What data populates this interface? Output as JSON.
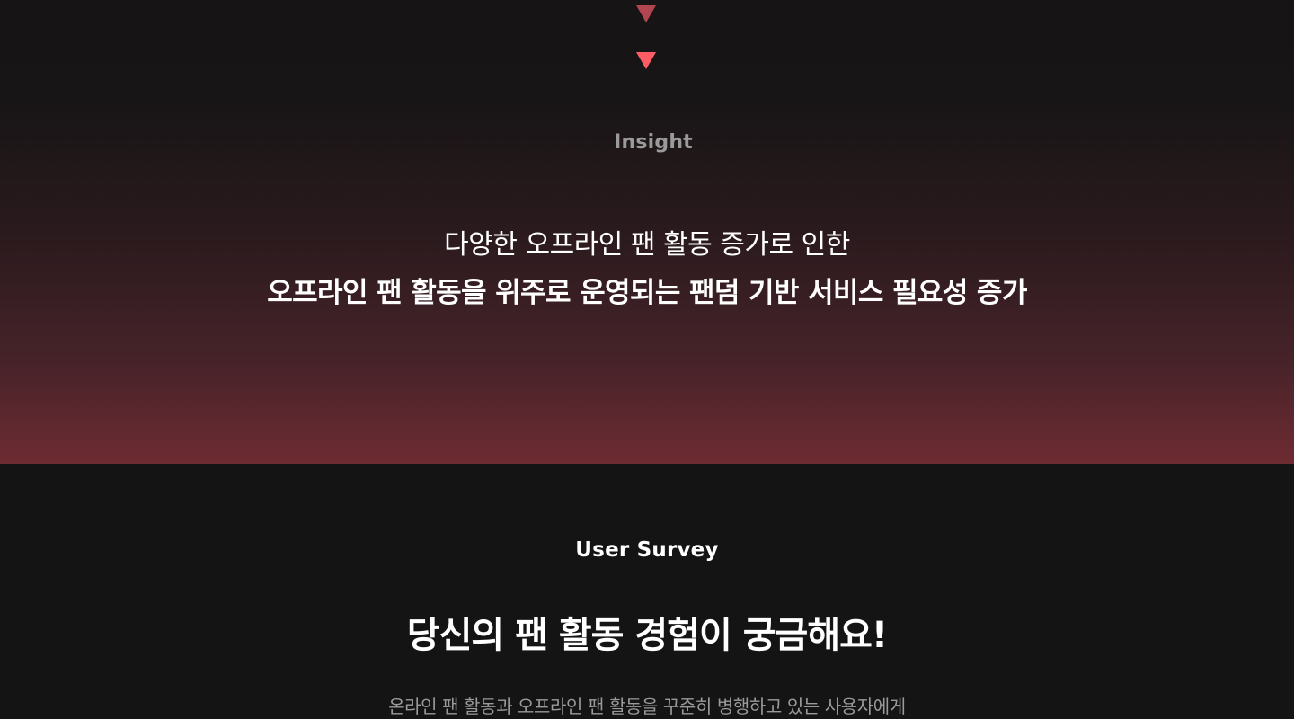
{
  "insight": {
    "label": "Insight",
    "line1": "다양한 오프라인 팬 활동 증가로 인한",
    "line2": "오프라인 팬 활동을 위주로 운영되는 팬덤 기반 서비스 필요성 증가",
    "arrow_colors": [
      "#b14651",
      "#ff5d66"
    ]
  },
  "survey": {
    "label": "User Survey",
    "title": "당신의 팬 활동 경험이 궁금해요!",
    "description": "온라인 팬 활동과 오프라인 팬 활동을 꾸준히 병행하고 있는 사용자에게"
  },
  "colors": {
    "background": "#141414",
    "accent": "#ff5d66",
    "muted_text": "#9a9a9a"
  }
}
